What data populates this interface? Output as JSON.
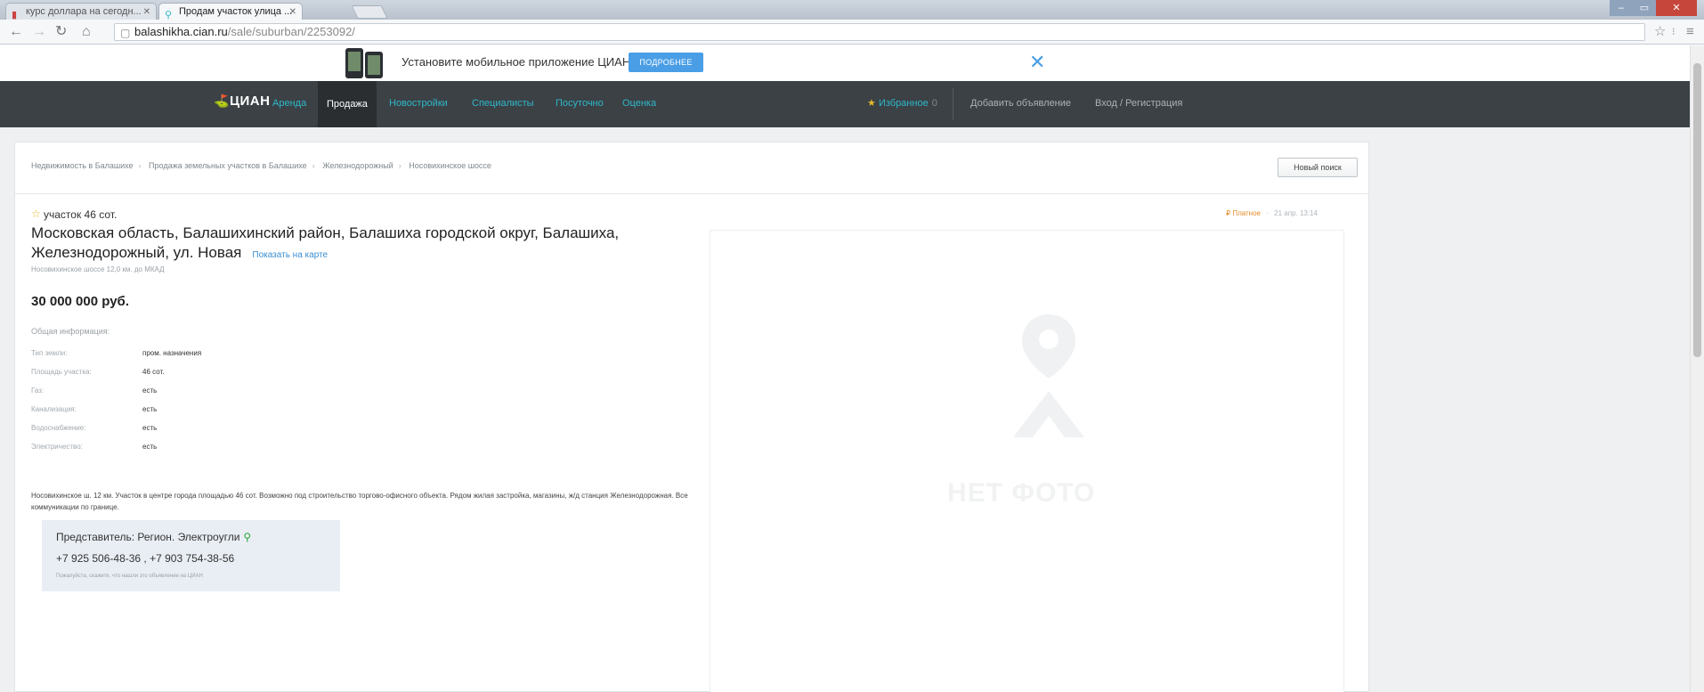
{
  "browser": {
    "tabs": [
      {
        "title": "курс доллара на сегодн..."
      },
      {
        "title": "Продам участок улица ..."
      }
    ],
    "url_host": "balashikha.cian.ru",
    "url_path": "/sale/suburban/2253092/"
  },
  "promo": {
    "text": "Установите мобильное приложение ЦИАН",
    "button": "ПОДРОБНЕЕ",
    "close": "✕"
  },
  "header": {
    "logo": "ЦИАН",
    "nav": [
      "Аренда",
      "Продажа",
      "Новостройки",
      "Специалисты",
      "Посуточно",
      "Оценка"
    ],
    "active_nav": "Продажа",
    "favorites": "Избранное",
    "favorites_count": "0",
    "add_listing": "Добавить объявление",
    "login": "Вход / Регистрация"
  },
  "breadcrumbs": [
    "Недвижимость в Балашихе",
    "Продажа земельных участков в Балашихе",
    "Железнодорожный",
    "Носовихинское шоссе"
  ],
  "new_search": "Новый поиск",
  "listing": {
    "subtitle": "участок 46 сот.",
    "address": "Московская область, Балашихинский район, Балашиха городской округ, Балашиха, Железнодорожный, ул. Новая",
    "map_link": "Показать на карте",
    "highway": "Носовихинское шоссе 12,0 км. до МКАД",
    "price": "30 000 000 руб.",
    "info_heading": "Общая информация:",
    "properties": [
      {
        "key": "Тип земли:",
        "value": "пром. назначения"
      },
      {
        "key": "Площадь участка:",
        "value": "46 сот."
      },
      {
        "key": "Газ:",
        "value": "есть"
      },
      {
        "key": "Канализация:",
        "value": "есть"
      },
      {
        "key": "Водоснабжение:",
        "value": "есть"
      },
      {
        "key": "Электричество:",
        "value": "есть"
      }
    ],
    "description": "Носовихинское ш. 12 км. Участок в центре города площадью 46 сот. Возможно под строительство торгово-офисного объекта. Рядом жилая застройка, магазины, ж/д станция Железнодорожная. Все коммуникации по границе.",
    "agent_name": "Представитель: Регион. Электроугли",
    "agent_phones": "+7 925 506-48-36 , +7 903 754-38-56",
    "agent_note": "Пожалуйста, скажите, что нашли это объявление на ЦИАН",
    "paid_label": "Платное",
    "date": "21 апр. 13:14",
    "no_photo": "НЕТ ФОТО"
  },
  "colors": {
    "header_bg": "#3b4145",
    "nav_link": "#2fb8c9",
    "promo_button": "#4a9ee6",
    "star": "#e2b92c",
    "paid": "#e38b26",
    "agent_bg": "#e9eef4"
  }
}
